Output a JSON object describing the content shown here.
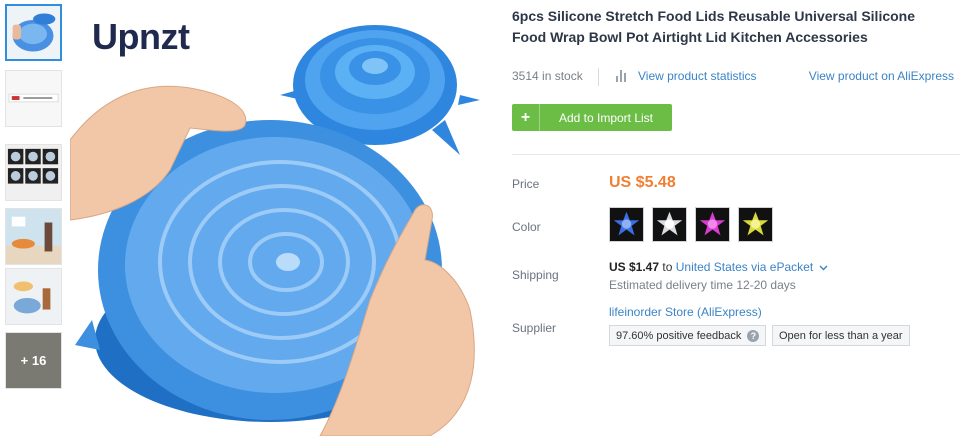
{
  "thumbnails": {
    "more_label": "+ 16"
  },
  "main_image": {
    "brand": "Upnzt"
  },
  "product": {
    "title": "6pcs Silicone Stretch Food Lids Reusable Universal Silicone Food Wrap Bowl Pot Airtight Lid Kitchen Accessories",
    "stock": "3514 in stock",
    "stats_link": "View product statistics",
    "aliexpress_link": "View product on AliExpress",
    "import_button": "Add to Import List",
    "import_button_icon": "+"
  },
  "price": {
    "label": "Price",
    "value": "US $5.48"
  },
  "color": {
    "label": "Color",
    "swatches": [
      {
        "name": "blue",
        "hex": "#3b6fe6"
      },
      {
        "name": "clear",
        "hex": "#d9dde2"
      },
      {
        "name": "pink",
        "hex": "#d93ad0"
      },
      {
        "name": "yellow",
        "hex": "#d9d93a"
      }
    ]
  },
  "shipping": {
    "label": "Shipping",
    "cost": "US $1.47",
    "to": "to",
    "destination": "United States via ePacket",
    "chevron_icon": "chevron-down-icon",
    "delivery": "Estimated delivery time 12-20 days"
  },
  "supplier": {
    "label": "Supplier",
    "store": "lifeinorder Store (AliExpress)",
    "feedback": "97.60% positive feedback",
    "help_icon": "?",
    "open_period": "Open for less than a year"
  },
  "colors": {
    "accent_link": "#3b83c6",
    "price": "#f07f32",
    "button": "#6cbd45"
  }
}
